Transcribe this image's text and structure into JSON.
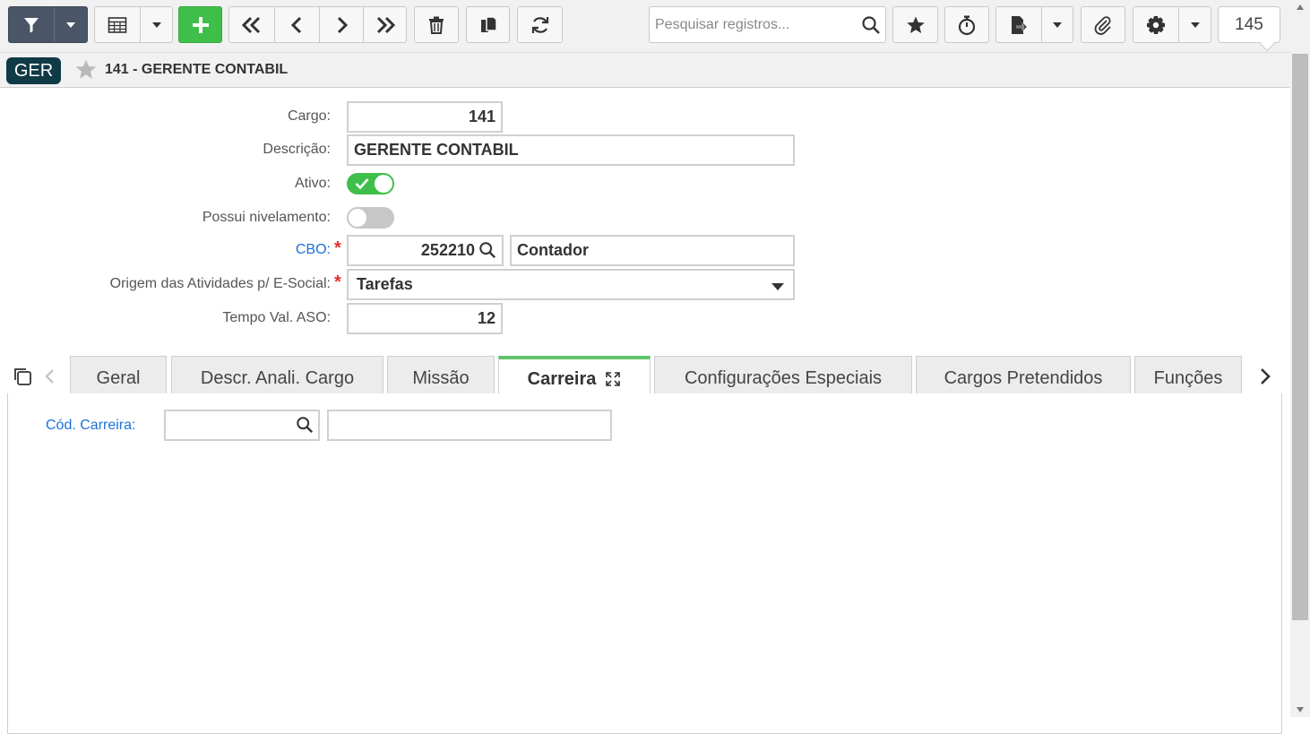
{
  "toolbar": {
    "search_placeholder": "Pesquisar registros...",
    "record_count": "145"
  },
  "header": {
    "badge": "GER",
    "title": "141 - GERENTE CONTABIL"
  },
  "form": {
    "cargo_label": "Cargo:",
    "cargo_value": "141",
    "descricao_label": "Descrição:",
    "descricao_value": "GERENTE CONTABIL",
    "ativo_label": "Ativo:",
    "ativo_on": true,
    "nivelamento_label": "Possui nivelamento:",
    "nivelamento_on": false,
    "cbo_label": "CBO:",
    "cbo_code": "252210",
    "cbo_desc": "Contador",
    "origem_label": "Origem das Atividades p/ E-Social:",
    "origem_value": "Tarefas",
    "tempo_label": "Tempo Val. ASO:",
    "tempo_value": "12",
    "required_mark": "*"
  },
  "tabs": [
    {
      "label": "Geral",
      "active": false
    },
    {
      "label": "Descr. Anali. Cargo",
      "active": false
    },
    {
      "label": "Missão",
      "active": false
    },
    {
      "label": "Carreira",
      "active": true
    },
    {
      "label": "Configurações Especiais",
      "active": false
    },
    {
      "label": "Cargos Pretendidos",
      "active": false
    },
    {
      "label": "Funções",
      "active": false
    }
  ],
  "carreira": {
    "cod_label": "Cód. Carreira:",
    "cod_value": "",
    "desc_value": ""
  },
  "colors": {
    "accent_green": "#3fbf4a",
    "filter_dark": "#4a5567",
    "badge": "#0f3a46",
    "link_blue": "#1a73d9",
    "required_red": "#e0322b"
  }
}
